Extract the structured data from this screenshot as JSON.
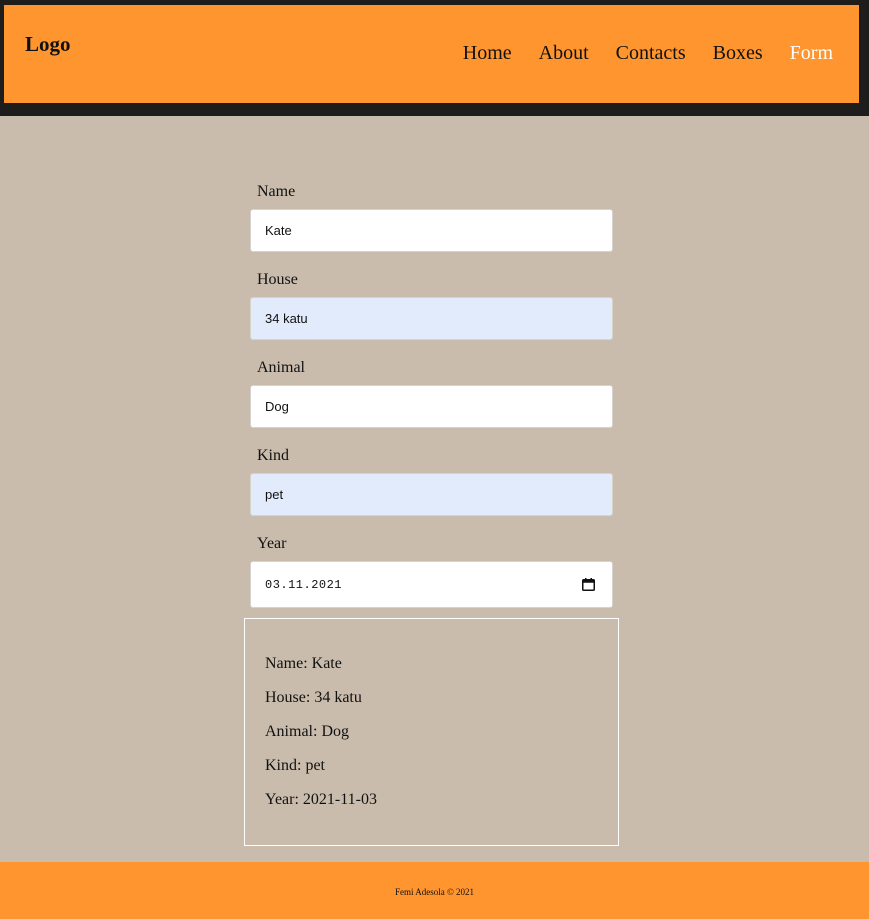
{
  "header": {
    "logo": "Logo",
    "nav": [
      "Home",
      "About",
      "Contacts",
      "Boxes",
      "Form"
    ],
    "active_nav": "Form"
  },
  "form": {
    "name": {
      "label": "Name",
      "value": "Kate"
    },
    "house": {
      "label": "House",
      "value": "34 katu"
    },
    "animal": {
      "label": "Animal",
      "value": "Dog"
    },
    "kind": {
      "label": "Kind",
      "value": "pet"
    },
    "year": {
      "label": "Year",
      "value": "03.11.2021",
      "icon": "calendar-icon"
    }
  },
  "summary": {
    "name": "Name: Kate",
    "house": "House: 34 katu",
    "animal": "Animal: Dog",
    "kind": "Kind: pet",
    "year": "Year: 2021-11-03"
  },
  "footer": {
    "text": "Femi Adesola © 2021"
  },
  "colors": {
    "header_bg": "#ff952e",
    "page_bg": "#c9bcad",
    "frame": "#1f1d1b",
    "autofill_bg": "#e1ebfb",
    "active_link": "#ffffff"
  }
}
